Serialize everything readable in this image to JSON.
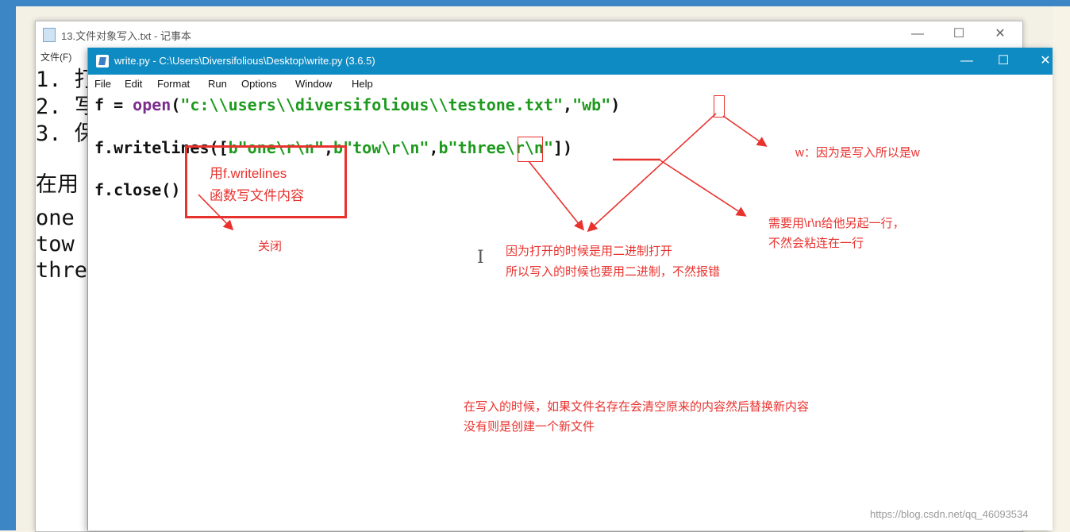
{
  "notepad": {
    "title": "13.文件对象写入.txt - 记事本",
    "menu_file": "文件(F)",
    "lines": [
      "1. 打",
      "2. 写",
      "3. 保",
      "在用",
      "one",
      "tow",
      "thre"
    ],
    "controls": {
      "min": "—",
      "max": "☐",
      "close": "✕"
    }
  },
  "idle": {
    "title": "write.py - C:\\Users\\Diversifolious\\Desktop\\write.py (3.6.5)",
    "menu": [
      "File",
      "Edit",
      "Format",
      "Run",
      "Options",
      "Window",
      "Help"
    ],
    "controls": {
      "min": "—",
      "max": "☐",
      "close": "✕"
    },
    "code": {
      "line1": {
        "a": "f = ",
        "b": "open",
        "c": "(",
        "d": "\"c:\\\\users\\\\diversifolious\\\\testone.txt\"",
        "e": ",",
        "f": "\"wb\"",
        "g": ")"
      },
      "line2": {
        "a": "f.writelines([",
        "b": "b\"one\\r\\n\"",
        "c": ",",
        "d": "b\"tow\\r\\n\"",
        "e": ",",
        "f": "b\"three\\r\\n\"",
        "g": "])"
      },
      "line3": "f.close()"
    }
  },
  "annotations": {
    "box_writelines_1": "用f.writelines",
    "box_writelines_2": "函数写文件内容",
    "close": "关闭",
    "wb": "w：因为是写入所以是w",
    "binary_1": "因为打开的时候是用二进制打开",
    "binary_2": "所以写入的时候也要用二进制，不然报错",
    "newline_1": "需要用\\r\\n给他另起一行，",
    "newline_2": "不然会粘连在一行",
    "overwrite_1": "在写入的时候，如果文件名存在会清空原来的内容然后替换新内容",
    "overwrite_2": "没有则是创建一个新文件"
  },
  "watermark": "https://blog.csdn.net/qq_46093534",
  "colors": {
    "annotation": "#e8322e",
    "idle_title": "#0f8bc3",
    "keyword": "#7b2d8b",
    "string": "#1d9a1d"
  }
}
